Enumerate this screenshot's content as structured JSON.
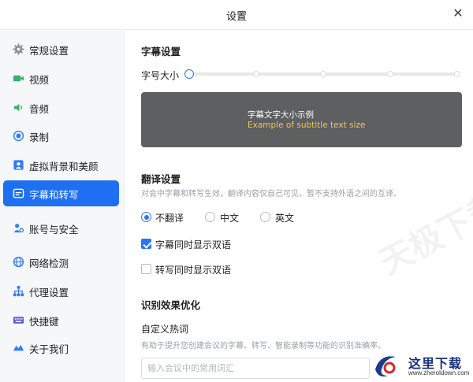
{
  "window": {
    "title": "设置",
    "close_label": "✕"
  },
  "sidebar": {
    "items": [
      {
        "label": "常规设置",
        "icon": "gear-icon",
        "color": "#8a8f98",
        "active": false
      },
      {
        "label": "视频",
        "icon": "video-icon",
        "color": "#3ab26b",
        "active": false
      },
      {
        "label": "音频",
        "icon": "speaker-icon",
        "color": "#3ab26b",
        "active": false
      },
      {
        "label": "录制",
        "icon": "record-icon",
        "color": "#2f7df5",
        "active": false
      },
      {
        "label": "虚拟背景和美颜",
        "icon": "portrait-icon",
        "color": "#2f7df5",
        "active": false
      },
      {
        "label": "字幕和转写",
        "icon": "subtitle-icon",
        "color": "#ffffff",
        "active": true
      },
      {
        "label": "账号与安全",
        "icon": "account-icon",
        "color": "#2f7df5",
        "active": false
      },
      {
        "label": "网络检测",
        "icon": "globe-icon",
        "color": "#2f7df5",
        "active": false
      },
      {
        "label": "代理设置",
        "icon": "proxy-icon",
        "color": "#2f7df5",
        "active": false
      },
      {
        "label": "快捷键",
        "icon": "keyboard-icon",
        "color": "#5b5bd6",
        "active": false
      },
      {
        "label": "关于我们",
        "icon": "about-icon",
        "color": "#2f7df5",
        "active": false
      }
    ]
  },
  "subtitle": {
    "section_title": "字幕设置",
    "font_size_label": "字号大小",
    "font_size_level": 0,
    "font_size_steps": 5,
    "preview_cn": "字幕文字大小示例",
    "preview_en": "Example of subtitle text size",
    "preview_bg": "#5e5f61",
    "preview_en_color": "#f2c257"
  },
  "translation": {
    "section_title": "翻译设置",
    "note": "对会中字幕和转写生效，翻译内容仅自己可见，暂不支持外语之间的互译。",
    "options": [
      {
        "label": "不翻译",
        "checked": true
      },
      {
        "label": "中文",
        "checked": false
      },
      {
        "label": "英文",
        "checked": false
      }
    ],
    "checkboxes": [
      {
        "label": "字幕同时显示双语",
        "checked": true
      },
      {
        "label": "转写同时显示双语",
        "checked": false
      }
    ]
  },
  "recognition": {
    "section_title": "识别效果优化",
    "hotword_label": "自定义热词",
    "hotword_note": "有助于提升您创建会议的字幕、转写、智能录制等功能的识别准确率。",
    "hotword_placeholder": "输入会议中的常用词汇"
  },
  "accent_color": "#1f6ff2",
  "watermark": "天极下载站",
  "logo": {
    "cn": "这里下载",
    "url": "www.zheroldown.com"
  }
}
